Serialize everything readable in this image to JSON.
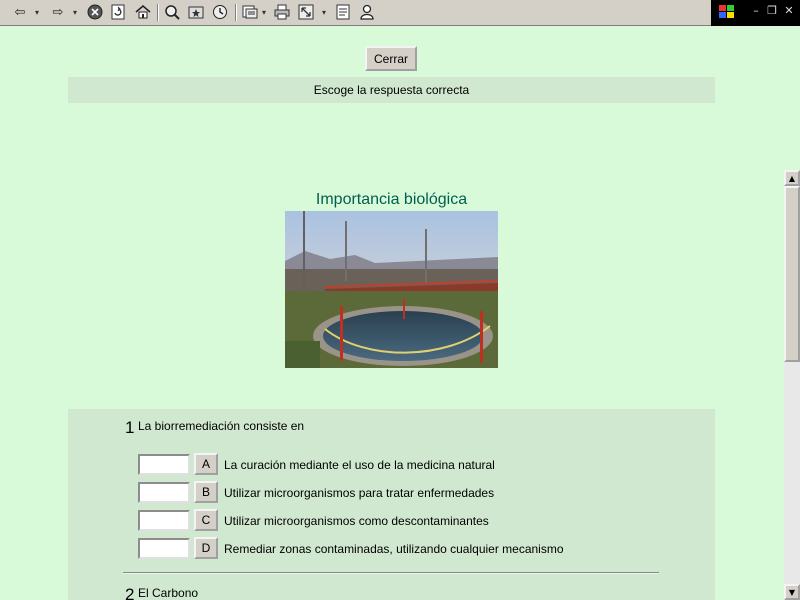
{
  "toolbar": {
    "icons": [
      "back-icon",
      "forward-icon",
      "stop-icon",
      "refresh-icon",
      "home-icon",
      "search-icon",
      "favorites-icon",
      "history-icon",
      "mail-icon",
      "print-icon",
      "fullscreen-icon",
      "edit-icon",
      "messenger-icon"
    ]
  },
  "window": {
    "minimize": "–",
    "restore": "❐",
    "close": "✕"
  },
  "page": {
    "close_label": "Cerrar",
    "instruction": "Escoge la respuesta correcta",
    "title": "Importancia biológica"
  },
  "quiz": {
    "questions": [
      {
        "number": "1",
        "text": "La biorremediación consiste en",
        "options": [
          {
            "letter": "A",
            "text": "La curación mediante el uso de la medicina natural",
            "value": ""
          },
          {
            "letter": "B",
            "text": "Utilizar microorganismos para tratar enfermedades",
            "value": ""
          },
          {
            "letter": "C",
            "text": "Utilizar microorganismos como descontaminantes",
            "value": ""
          },
          {
            "letter": "D",
            "text": "Remediar zonas contaminadas, utilizando cualquier mecanismo",
            "value": ""
          }
        ]
      },
      {
        "number": "2",
        "text": "El Carbono"
      }
    ]
  },
  "scrollbar": {
    "up": "▲",
    "down": "▼"
  },
  "colors": {
    "page_bg": "#d9fad9",
    "panel_bg": "#d0e8d0",
    "title": "#006050"
  }
}
